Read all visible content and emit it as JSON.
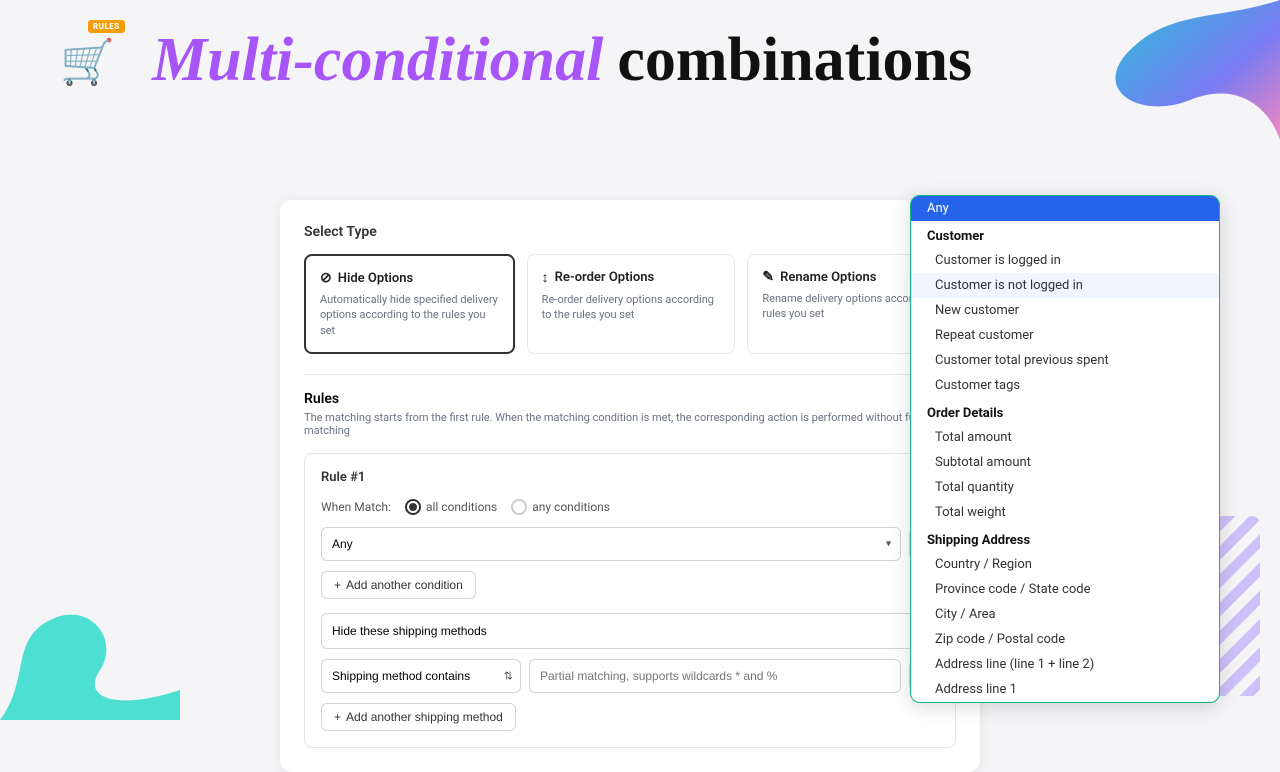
{
  "header": {
    "logo_emoji": "🛒",
    "logo_badge": "RULES",
    "title_part1": "Multi-conditional",
    "title_part2": "combinations"
  },
  "select_type": {
    "label": "Select Type",
    "cards": [
      {
        "id": "hide",
        "icon": "⊘",
        "label": "Hide Options",
        "desc": "Automatically hide specified delivery options according to the rules you set",
        "selected": true
      },
      {
        "id": "reorder",
        "icon": "↕",
        "label": "Re-order Options",
        "desc": "Re-order delivery options according to the rules you set",
        "selected": false
      },
      {
        "id": "rename",
        "icon": "✎",
        "label": "Rename Options",
        "desc": "Rename delivery options accord... rules you set",
        "selected": false
      }
    ]
  },
  "rules": {
    "title": "Rules",
    "desc": "The matching starts from the first rule. When the matching condition is met, the corresponding action is performed without further matching",
    "rule1": {
      "label": "Rule #1",
      "when_match_label": "When Match:",
      "options": [
        {
          "id": "all",
          "label": "all conditions",
          "checked": true
        },
        {
          "id": "any",
          "label": "any conditions",
          "checked": false
        }
      ],
      "condition_value": "Any",
      "add_condition_label": "Add another condition",
      "shipping_action": "Hide these shipping methods",
      "shipping_method_select": "Shipping method contains",
      "shipping_method_value": "Partial matching, supports wildcards * and %",
      "add_shipping_label": "Add another shipping method"
    }
  },
  "dropdown": {
    "items": [
      {
        "type": "selected",
        "label": "Any"
      },
      {
        "type": "category",
        "label": "Customer"
      },
      {
        "type": "option",
        "label": "Customer is logged in"
      },
      {
        "type": "option",
        "label": "Customer is not logged in",
        "highlighted": true
      },
      {
        "type": "option",
        "label": "New customer"
      },
      {
        "type": "option",
        "label": "Repeat customer"
      },
      {
        "type": "option",
        "label": "Customer total previous spent"
      },
      {
        "type": "option",
        "label": "Customer tags"
      },
      {
        "type": "category",
        "label": "Order Details"
      },
      {
        "type": "option",
        "label": "Total amount"
      },
      {
        "type": "option",
        "label": "Subtotal amount"
      },
      {
        "type": "option",
        "label": "Total quantity"
      },
      {
        "type": "option",
        "label": "Total weight"
      },
      {
        "type": "category",
        "label": "Shipping Address"
      },
      {
        "type": "option",
        "label": "Country / Region"
      },
      {
        "type": "option",
        "label": "Province code / State code"
      },
      {
        "type": "option",
        "label": "City / Area"
      },
      {
        "type": "option",
        "label": "Zip code / Postal code"
      },
      {
        "type": "option",
        "label": "Address line (line 1 + line 2)"
      },
      {
        "type": "option",
        "label": "Address line 1"
      }
    ]
  }
}
